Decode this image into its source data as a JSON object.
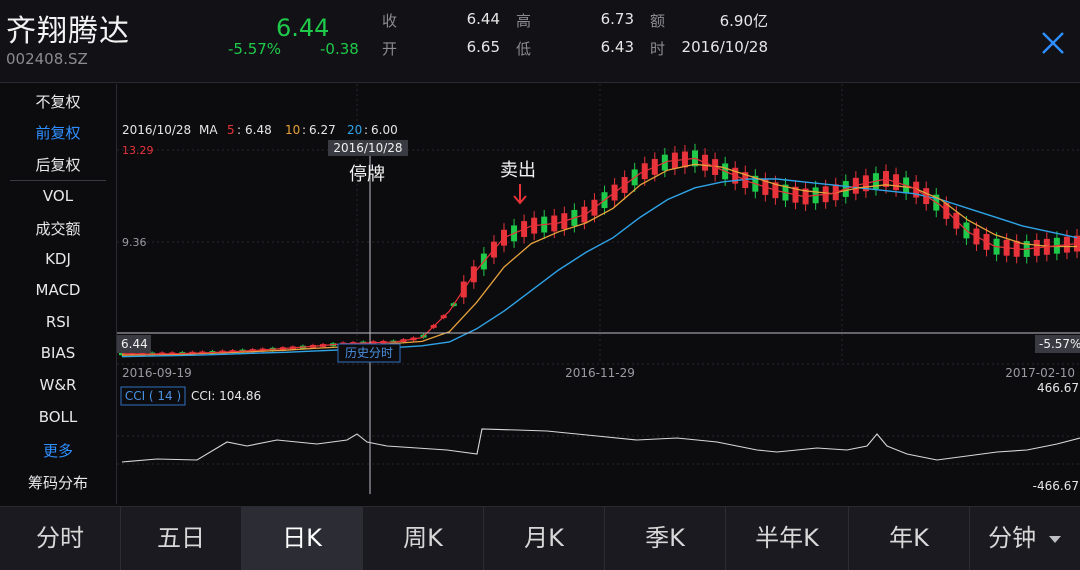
{
  "stock": {
    "name": "齐翔腾达",
    "code": "002408.SZ",
    "price": "6.44",
    "change_pct": "-5.57%",
    "change": "-0.38"
  },
  "quote": {
    "close_label": "收",
    "close": "6.44",
    "open_label": "开",
    "open": "6.65",
    "high_label": "高",
    "high": "6.73",
    "low_label": "低",
    "low": "6.43",
    "amount_label": "额",
    "amount": "6.90亿",
    "time_label": "时",
    "time": "2016/10/28"
  },
  "colors": {
    "up": "#e8333a",
    "down": "#1fc94a",
    "ma5": "#e8333a",
    "ma10": "#e6a23c",
    "ma20": "#2fa3e6",
    "accent": "#2f8fff"
  },
  "sidebar": {
    "items": [
      {
        "label": "不复权",
        "active": false
      },
      {
        "label": "前复权",
        "active": true
      },
      {
        "label": "后复权",
        "active": false
      },
      {
        "label": "VOL",
        "active": false
      },
      {
        "label": "成交额",
        "active": false
      },
      {
        "label": "KDJ",
        "active": false
      },
      {
        "label": "MACD",
        "active": false
      },
      {
        "label": "RSI",
        "active": false
      },
      {
        "label": "BIAS",
        "active": false
      },
      {
        "label": "W&R",
        "active": false
      },
      {
        "label": "BOLL",
        "active": false
      },
      {
        "label": "更多",
        "active": true
      },
      {
        "label": "筹码分布",
        "active": false
      }
    ]
  },
  "chart_info": {
    "date": "2016/10/28",
    "ma_label": "MA",
    "ma5_label": "5",
    "ma5": "6.48",
    "ma10_label": "10",
    "ma10": "6.27",
    "ma20_label": "20",
    "ma20": "6.00",
    "y_max": "13.29",
    "y_mid": "9.36",
    "crosshair_date": "2016/10/28",
    "crosshair_price": "6.44",
    "crosshair_pct": "-5.57%",
    "x_labels": [
      "2016-09-19",
      "2016-11-29",
      "2017-02-10"
    ],
    "annotation_halt": "停牌",
    "annotation_sell": "卖出",
    "history_btn": "历史分时",
    "cci_label": "CCI ( 14 )",
    "cci_value": "CCI: 104.86",
    "cci_max": "466.67",
    "cci_min": "-466.67"
  },
  "chart_data": {
    "type": "line",
    "x_range": [
      "2016-09-19",
      "2017-02-10"
    ],
    "ylim": [
      6.44,
      13.29
    ],
    "series": [
      {
        "name": "MA5",
        "values": [
          6.15,
          6.14,
          6.15,
          6.18,
          6.22,
          6.27,
          6.33,
          6.4,
          6.48,
          6.52,
          6.55,
          6.7,
          7.6,
          9.0,
          10.1,
          10.5,
          10.6,
          10.9,
          11.6,
          12.3,
          12.7,
          12.8,
          12.4,
          12.0,
          11.7,
          11.5,
          11.6,
          11.9,
          12.1,
          11.8,
          11.2,
          10.3,
          9.8,
          9.7,
          9.8,
          9.9
        ]
      },
      {
        "name": "MA10",
        "values": [
          6.1,
          6.12,
          6.13,
          6.16,
          6.19,
          6.23,
          6.27,
          6.33,
          6.38,
          6.44,
          6.5,
          6.57,
          6.9,
          7.9,
          9.1,
          9.9,
          10.3,
          10.6,
          11.1,
          11.9,
          12.4,
          12.6,
          12.5,
          12.2,
          11.9,
          11.7,
          11.6,
          11.8,
          11.9,
          11.8,
          11.4,
          10.7,
          10.2,
          9.9,
          9.8,
          9.8
        ]
      },
      {
        "name": "MA20",
        "values": [
          6.05,
          6.07,
          6.09,
          6.11,
          6.14,
          6.17,
          6.2,
          6.24,
          6.28,
          6.31,
          6.36,
          6.42,
          6.55,
          7.0,
          7.6,
          8.3,
          9.0,
          9.6,
          10.1,
          10.8,
          11.4,
          11.8,
          12.0,
          12.1,
          12.1,
          12.0,
          11.9,
          11.8,
          11.7,
          11.6,
          11.4,
          11.1,
          10.8,
          10.5,
          10.3,
          10.1
        ]
      }
    ]
  }
}
